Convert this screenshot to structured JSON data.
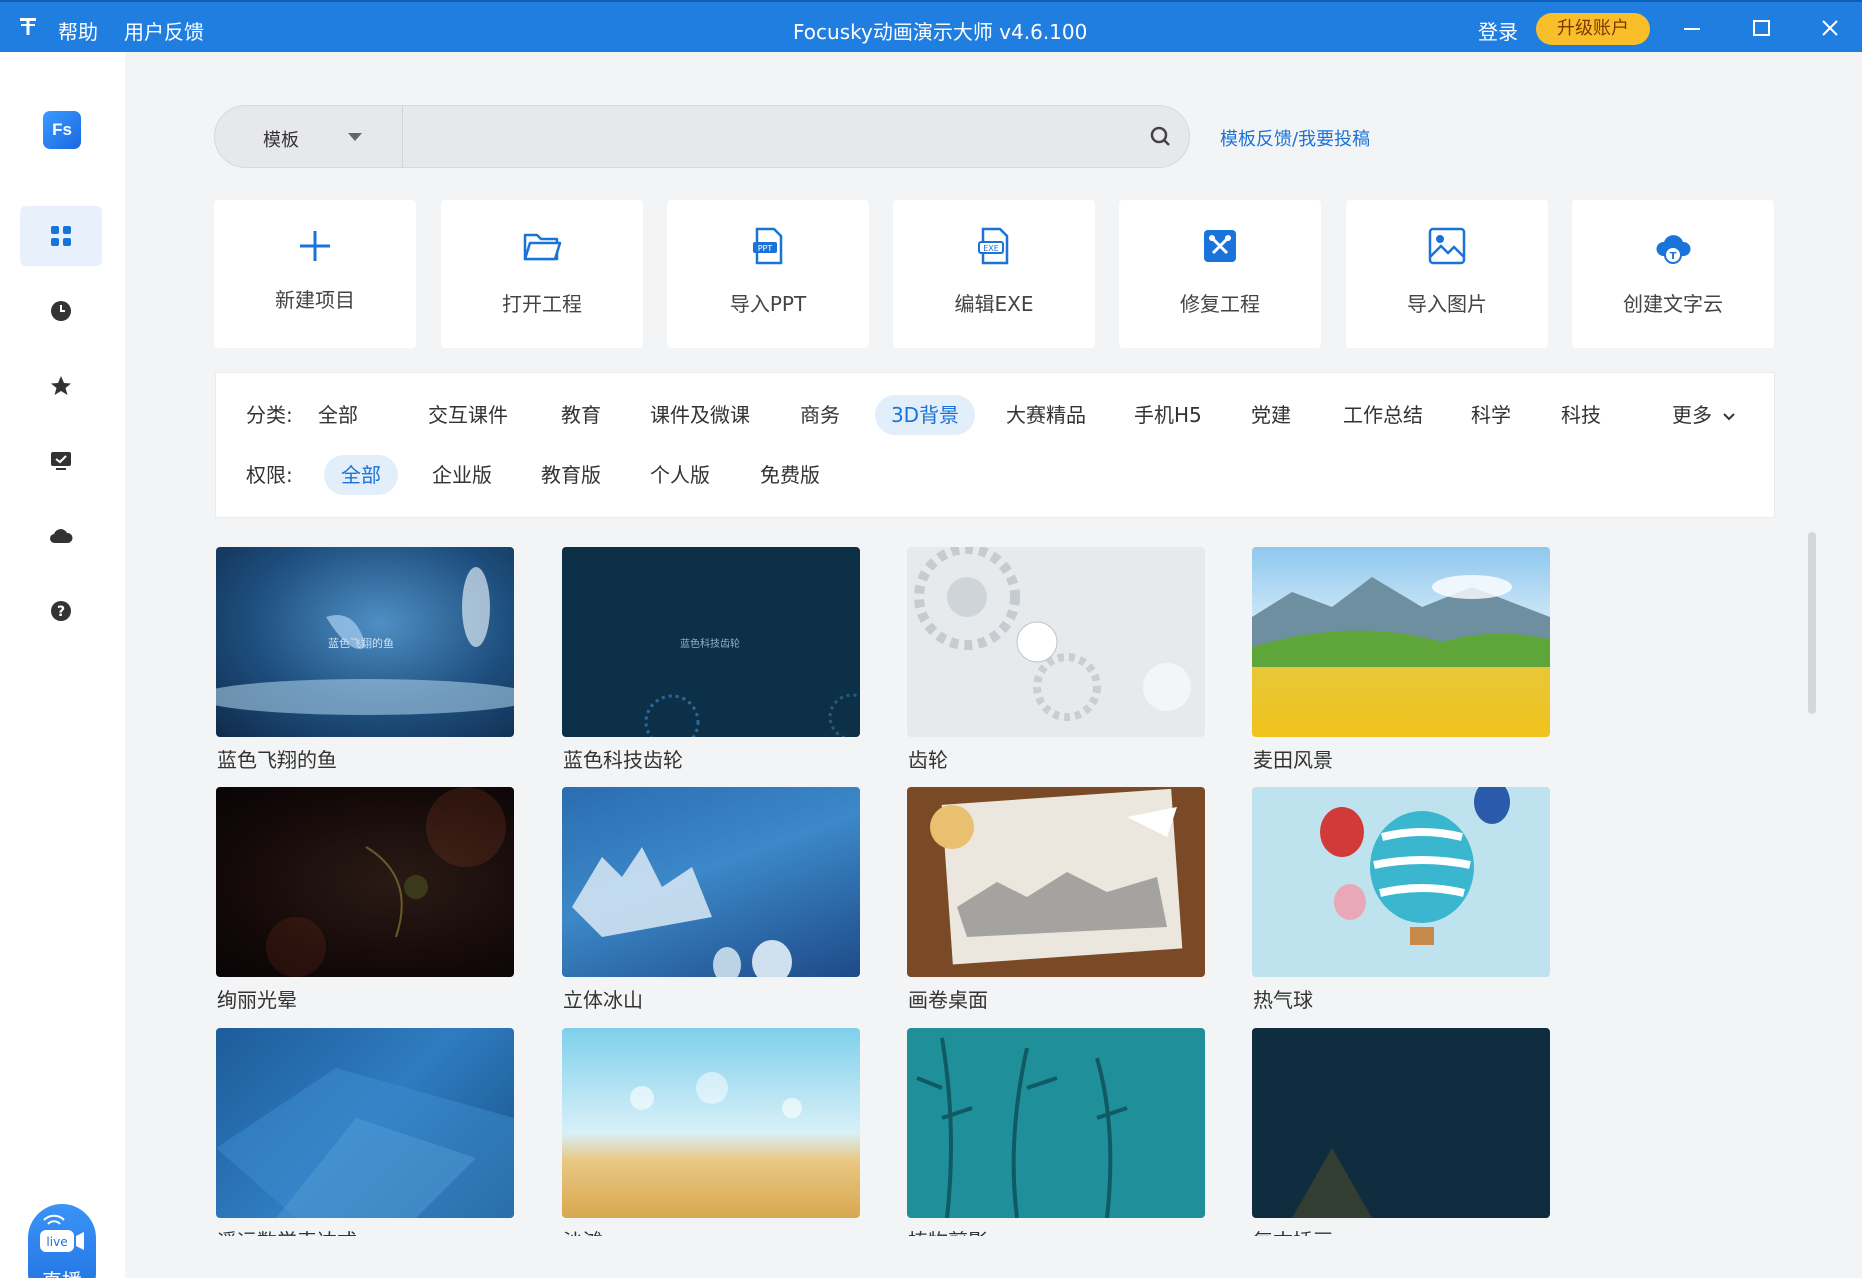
{
  "colors": {
    "accent": "#1f7ee0",
    "link": "#1a73d8",
    "upgrade": "#f9bf2a"
  },
  "titlebar": {
    "help": "帮助",
    "feedback": "用户反馈",
    "title": "Focusky动画演示大师 v4.6.100",
    "login": "登录",
    "upgrade": "升级账户"
  },
  "sidebar": {
    "logo": "Fs",
    "items": [
      "grid-icon",
      "clock-icon",
      "star-icon",
      "screen-check-icon",
      "cloud-icon",
      "help-icon"
    ],
    "live_badge": "live",
    "live_label": "直播"
  },
  "search": {
    "scope": "模板",
    "value": "",
    "placeholder": "",
    "feedback_link": "模板反馈/我要投稿"
  },
  "actions": [
    {
      "label": "新建项目",
      "icon": "plus-icon"
    },
    {
      "label": "打开工程",
      "icon": "folder-icon"
    },
    {
      "label": "导入PPT",
      "icon": "ppt-file-icon"
    },
    {
      "label": "编辑EXE",
      "icon": "exe-file-icon"
    },
    {
      "label": "修复工程",
      "icon": "repair-tools-icon"
    },
    {
      "label": "导入图片",
      "icon": "image-icon"
    },
    {
      "label": "创建文字云",
      "icon": "text-cloud-icon"
    }
  ],
  "filters": {
    "category_label": "分类:",
    "categories": [
      "全部",
      "交互课件",
      "教育",
      "课件及微课",
      "商务",
      "3D背景",
      "大赛精品",
      "手机H5",
      "党建",
      "工作总结",
      "科学",
      "科技"
    ],
    "category_active": "3D背景",
    "more": "更多",
    "permission_label": "权限:",
    "permissions": [
      "全部",
      "企业版",
      "教育版",
      "个人版",
      "免费版"
    ],
    "permission_active": "全部"
  },
  "templates": [
    {
      "title": "蓝色飞翔的鱼",
      "overlay": "蓝色飞翔的鱼"
    },
    {
      "title": "蓝色科技齿轮",
      "overlay": "蓝色科技齿轮"
    },
    {
      "title": "齿轮",
      "overlay": ""
    },
    {
      "title": "麦田风景",
      "overlay": ""
    },
    {
      "title": "绚丽光晕",
      "overlay": ""
    },
    {
      "title": "立体冰山",
      "overlay": ""
    },
    {
      "title": "画卷桌面",
      "overlay": ""
    },
    {
      "title": "热气球",
      "overlay": ""
    },
    {
      "title": "遥远数学表达式",
      "overlay": ""
    },
    {
      "title": "沙滩",
      "overlay": ""
    },
    {
      "title": "植物剪影",
      "overlay": ""
    },
    {
      "title": "复古插画",
      "overlay": ""
    }
  ]
}
